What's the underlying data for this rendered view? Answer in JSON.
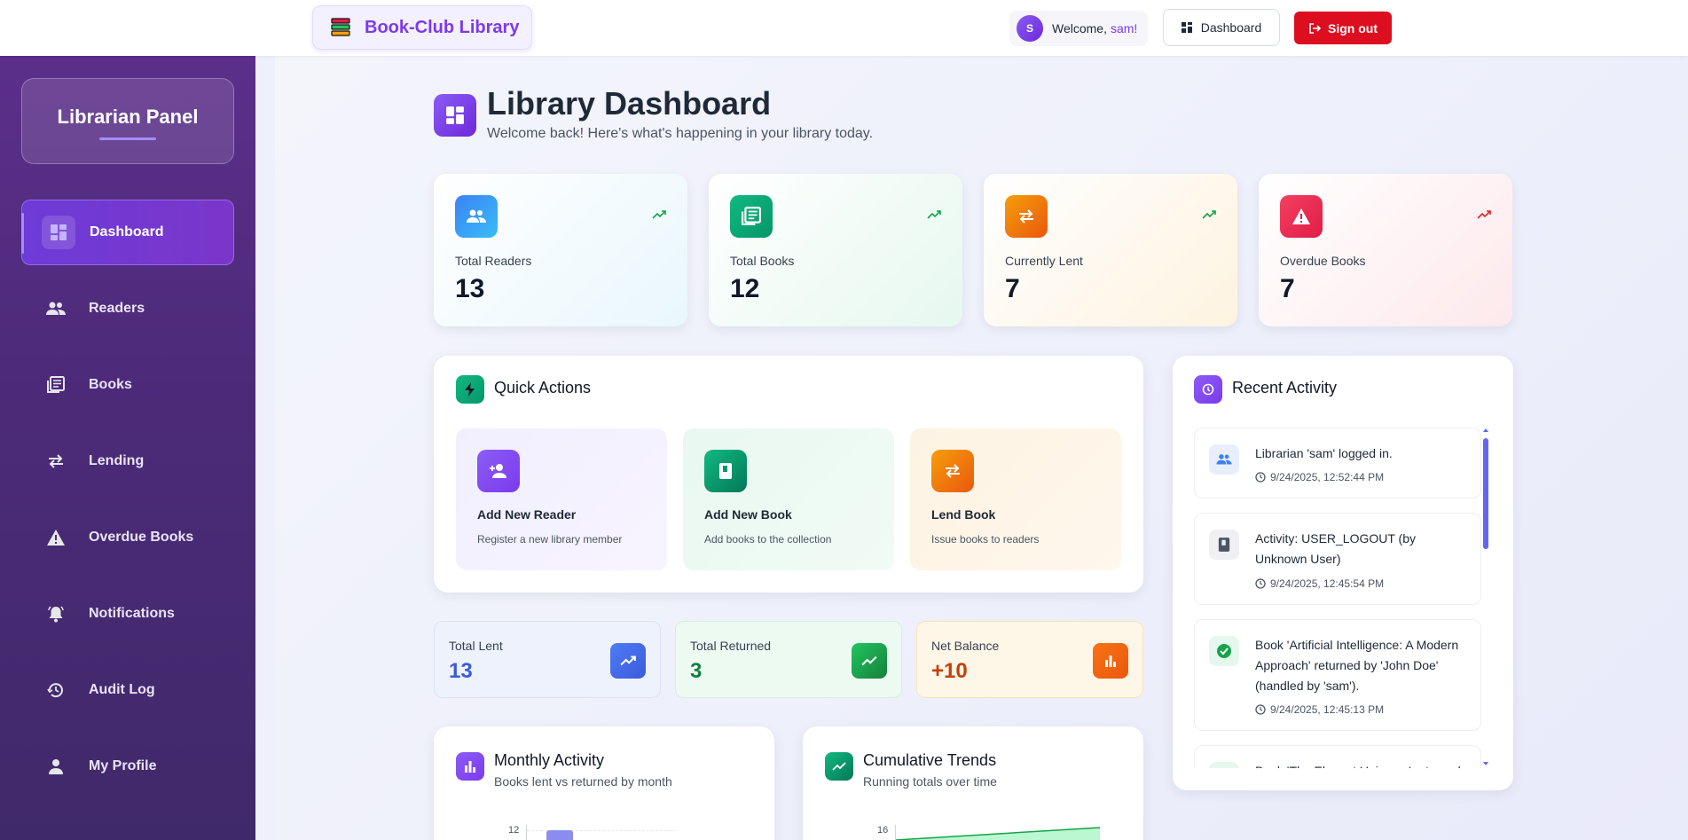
{
  "topbar": {
    "brand": "Book-Club Library",
    "welcome_prefix": "Welcome,",
    "username": "sam!",
    "avatar_letter": "S",
    "dashboard_button": "Dashboard",
    "signout_button": "Sign out"
  },
  "sidebar": {
    "panel_title": "Librarian Panel",
    "items": [
      {
        "label": "Dashboard",
        "icon": "dashboard-icon",
        "active": true
      },
      {
        "label": "Readers",
        "icon": "people-icon"
      },
      {
        "label": "Books",
        "icon": "books-icon"
      },
      {
        "label": "Lending",
        "icon": "swap-icon"
      },
      {
        "label": "Overdue Books",
        "icon": "warning-icon"
      },
      {
        "label": "Notifications",
        "icon": "bell-icon"
      },
      {
        "label": "Audit Log",
        "icon": "history-icon"
      },
      {
        "label": "My Profile",
        "icon": "person-icon"
      }
    ]
  },
  "header": {
    "title": "Library Dashboard",
    "subtitle": "Welcome back! Here's what's happening in your library today."
  },
  "stats": [
    {
      "label": "Total Readers",
      "value": "13",
      "icon": "people-icon",
      "trend_color": "#16a34a"
    },
    {
      "label": "Total Books",
      "value": "12",
      "icon": "books-icon",
      "trend_color": "#16a34a"
    },
    {
      "label": "Currently Lent",
      "value": "7",
      "icon": "swap-icon",
      "trend_color": "#16a34a"
    },
    {
      "label": "Overdue Books",
      "value": "7",
      "icon": "warning-icon",
      "trend_color": "#dc2626"
    }
  ],
  "quick_actions": {
    "title": "Quick Actions",
    "items": [
      {
        "title": "Add New Reader",
        "desc": "Register a new library member"
      },
      {
        "title": "Add New Book",
        "desc": "Add books to the collection"
      },
      {
        "title": "Lend Book",
        "desc": "Issue books to readers"
      }
    ]
  },
  "summary": [
    {
      "label": "Total Lent",
      "value": "13",
      "color": "#3b5bdb"
    },
    {
      "label": "Total Returned",
      "value": "3",
      "color": "#15803d"
    },
    {
      "label": "Net Balance",
      "value": "+10",
      "color": "#c2410c"
    }
  ],
  "recent_activity": {
    "title": "Recent Activity",
    "items": [
      {
        "text": "Librarian 'sam' logged in.",
        "time": "9/24/2025, 12:52:44 PM",
        "icon": "people-icon"
      },
      {
        "text": "Activity: USER_LOGOUT (by Unknown User)",
        "time": "9/24/2025, 12:45:54 PM",
        "icon": "book-icon"
      },
      {
        "text": "Book 'Artificial Intelligence: A Modern Approach' returned by 'John Doe' (handled by 'sam').",
        "time": "9/24/2025, 12:45:13 PM",
        "icon": "check-icon"
      },
      {
        "text": "Book 'The Elegant Universe' returned",
        "time": "",
        "icon": "check-icon"
      }
    ]
  },
  "charts": {
    "monthly": {
      "title": "Monthly Activity",
      "subtitle": "Books lent vs returned by month",
      "ytick": "12"
    },
    "cumulative": {
      "title": "Cumulative Trends",
      "subtitle": "Running totals over time",
      "ytick": "16"
    }
  },
  "colors": {
    "accent": "#7c3aed",
    "danger": "#dc0e1f"
  }
}
